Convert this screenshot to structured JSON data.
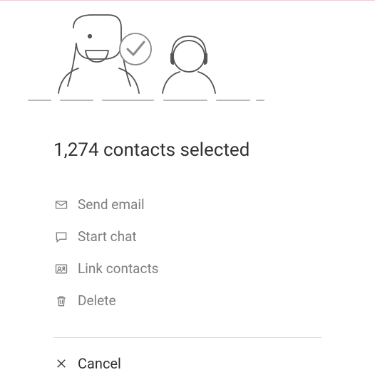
{
  "title": "1,274 contacts selected",
  "actions": {
    "send_email": {
      "label": "Send email"
    },
    "start_chat": {
      "label": "Start chat"
    },
    "link_contacts": {
      "label": "Link contacts"
    },
    "delete": {
      "label": "Delete"
    }
  },
  "cancel": {
    "label": "Cancel"
  }
}
